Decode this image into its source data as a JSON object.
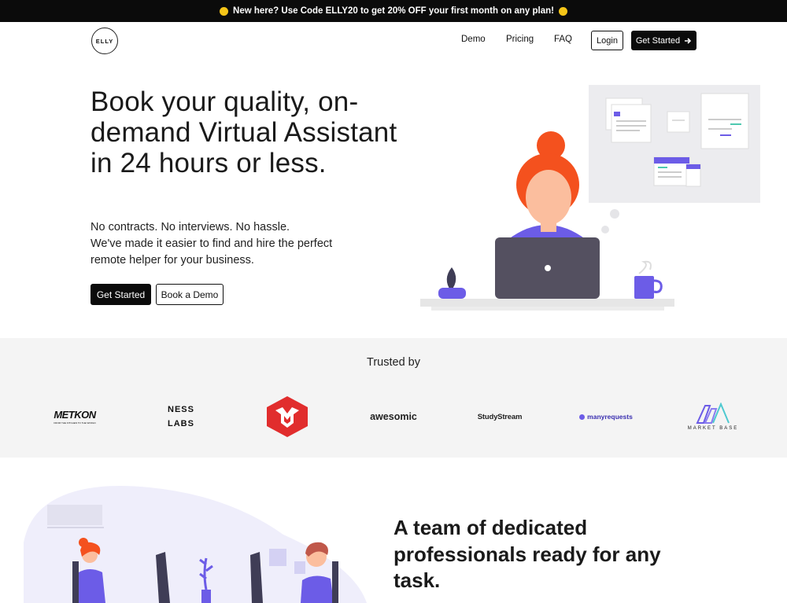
{
  "promo": {
    "text": "New here? Use Code ELLY20 to get 20% OFF your first month on any plan!"
  },
  "nav": {
    "logo_text": "ELLY",
    "links": [
      "Demo",
      "Pricing",
      "FAQ"
    ],
    "login_label": "Login",
    "cta_label": "Get Started"
  },
  "hero": {
    "title": "Book your quality, on-demand Virtual Assistant in 24 hours or less.",
    "subtitle_lines": [
      "No contracts. No interviews. No hassle.",
      "We've made it easier to find and hire the perfect",
      "remote helper for your business."
    ],
    "primary_button": "Get Started",
    "secondary_button": "Book a Demo"
  },
  "trusted": {
    "title": "Trusted by",
    "logos": [
      {
        "name": "METKON",
        "caption": "FROM THE KITCHEN TO THE WORLD"
      },
      {
        "name": "NESS LABS"
      },
      {
        "name": "M-shield"
      },
      {
        "name": "awesomic"
      },
      {
        "name": "StudyStream"
      },
      {
        "name": "manyrequests"
      },
      {
        "name": "MARKET BASE"
      }
    ]
  },
  "team": {
    "title": "A team of dedicated professionals ready for any task."
  },
  "colors": {
    "accent": "#6c5ce7",
    "hair": "#f4511e",
    "skin": "#fbbe9e",
    "dark": "#0b0b0b",
    "light_bg": "#f4f4f4"
  }
}
